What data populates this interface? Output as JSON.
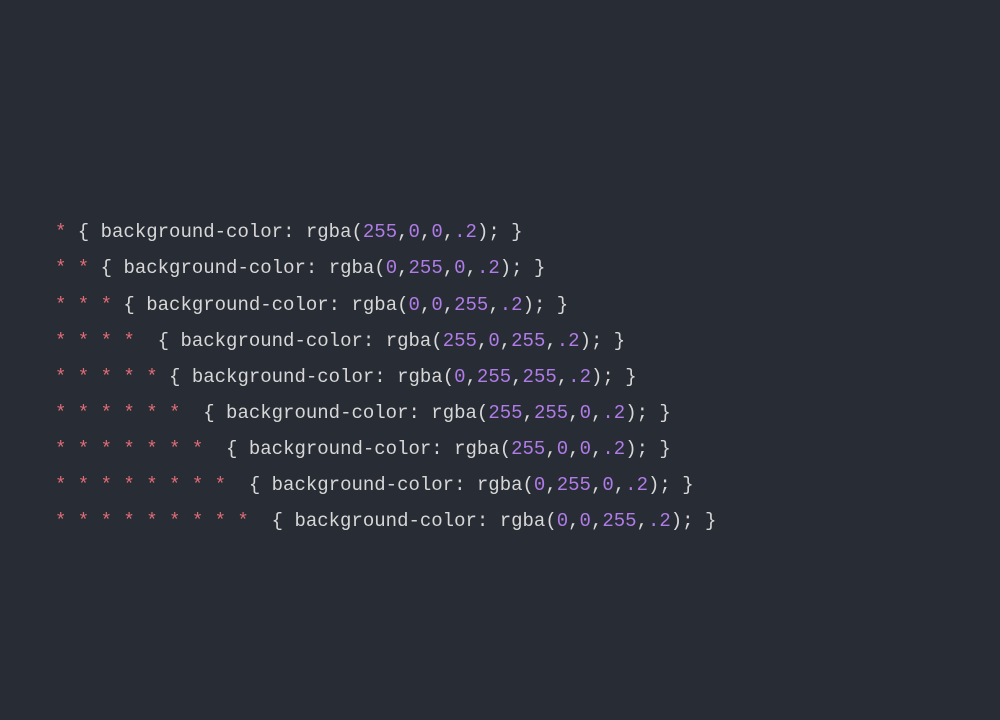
{
  "theme": {
    "background": "#282c34",
    "selector_color": "#e06c75",
    "number_color": "#b07ce8",
    "text_color": "#d7d7d7"
  },
  "code": {
    "property": "background-color",
    "func_name": "rgba",
    "lines": [
      {
        "selector": "*",
        "r": "255",
        "g": "0",
        "b": "0",
        "a": ".2"
      },
      {
        "selector": "* *",
        "r": "0",
        "g": "255",
        "b": "0",
        "a": ".2"
      },
      {
        "selector": "* * *",
        "r": "0",
        "g": "0",
        "b": "255",
        "a": ".2"
      },
      {
        "selector": "* * * * ",
        "r": "255",
        "g": "0",
        "b": "255",
        "a": ".2"
      },
      {
        "selector": "* * * * *",
        "r": "0",
        "g": "255",
        "b": "255",
        "a": ".2"
      },
      {
        "selector": "* * * * * * ",
        "r": "255",
        "g": "255",
        "b": "0",
        "a": ".2"
      },
      {
        "selector": "* * * * * * * ",
        "r": "255",
        "g": "0",
        "b": "0",
        "a": ".2"
      },
      {
        "selector": "* * * * * * * * ",
        "r": "0",
        "g": "255",
        "b": "0",
        "a": ".2"
      },
      {
        "selector": "* * * * * * * * * ",
        "r": "0",
        "g": "0",
        "b": "255",
        "a": ".2"
      }
    ]
  }
}
